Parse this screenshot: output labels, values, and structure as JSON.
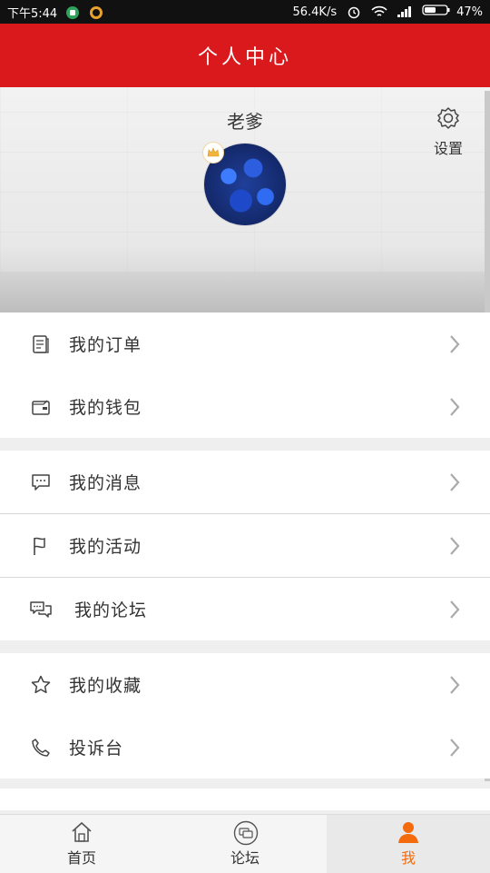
{
  "status_bar": {
    "time": "下午5:44",
    "net_speed": "56.4K/s",
    "battery": "47%"
  },
  "header": {
    "title": "个人中心"
  },
  "profile": {
    "username": "老爹",
    "settings_label": "设置"
  },
  "menu": {
    "groups": [
      [
        {
          "label": "我的订单",
          "icon": "order-icon"
        },
        {
          "label": "我的钱包",
          "icon": "wallet-icon"
        }
      ],
      [
        {
          "label": "我的消息",
          "icon": "message-icon"
        },
        {
          "label": "我的活动",
          "icon": "flag-icon"
        },
        {
          "label": "我的论坛",
          "icon": "forum-icon"
        }
      ],
      [
        {
          "label": "我的收藏",
          "icon": "star-icon"
        },
        {
          "label": "投诉台",
          "icon": "phone-icon"
        }
      ]
    ]
  },
  "bottom_nav": {
    "tabs": [
      {
        "label": "首页",
        "icon": "home-icon"
      },
      {
        "label": "论坛",
        "icon": "forum-tab-icon"
      },
      {
        "label": "我",
        "icon": "user-icon"
      }
    ],
    "active_color": "#f36b0d"
  },
  "colors": {
    "accent": "#d9191c"
  }
}
